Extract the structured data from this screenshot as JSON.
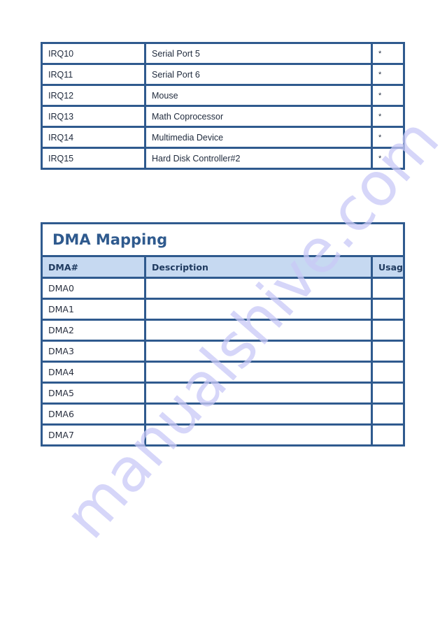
{
  "irq_table": {
    "rows": [
      {
        "irq": "IRQ10",
        "description": "Serial Port 5",
        "usage": "*"
      },
      {
        "irq": "IRQ11",
        "description": "Serial Port 6",
        "usage": "*"
      },
      {
        "irq": "IRQ12",
        "description": "Mouse",
        "usage": "*"
      },
      {
        "irq": "IRQ13",
        "description": "Math Coprocessor",
        "usage": "*"
      },
      {
        "irq": "IRQ14",
        "description": "Multimedia Device",
        "usage": "*"
      },
      {
        "irq": "IRQ15",
        "description": "Hard Disk Controller#2",
        "usage": "*"
      }
    ]
  },
  "dma_table": {
    "title": "DMA Mapping",
    "headers": [
      "DMA#",
      "Description",
      "Usage"
    ],
    "rows": [
      {
        "dma": "DMA0",
        "description": "",
        "usage": ""
      },
      {
        "dma": "DMA1",
        "description": "",
        "usage": ""
      },
      {
        "dma": "DMA2",
        "description": "",
        "usage": ""
      },
      {
        "dma": "DMA3",
        "description": "",
        "usage": ""
      },
      {
        "dma": "DMA4",
        "description": "",
        "usage": ""
      },
      {
        "dma": "DMA5",
        "description": "",
        "usage": ""
      },
      {
        "dma": "DMA6",
        "description": "",
        "usage": ""
      },
      {
        "dma": "DMA7",
        "description": "",
        "usage": ""
      }
    ]
  },
  "watermark": "manualshive.com",
  "colors": {
    "border": "#2f5a8e",
    "header_bg": "#c6d9f1",
    "title": "#2f5a8e",
    "watermark": "#c9c9f7"
  }
}
